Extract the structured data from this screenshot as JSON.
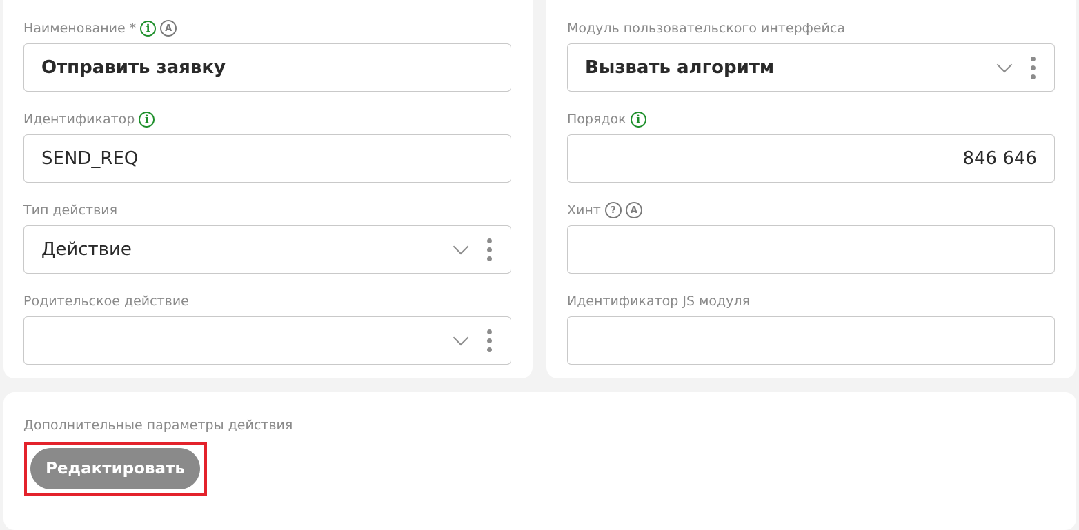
{
  "left_column": {
    "name": {
      "label": "Наименование",
      "required_mark": "*",
      "value": "Отправить заявку",
      "info_icon": "info-icon",
      "auto_icon": "A"
    },
    "identifier": {
      "label": "Идентификатор",
      "value": "SEND_REQ",
      "info_icon": "info-icon"
    },
    "action_type": {
      "label": "Тип действия",
      "value": "Действие"
    },
    "parent_action": {
      "label": "Родительское действие",
      "value": ""
    }
  },
  "right_column": {
    "ui_module": {
      "label": "Модуль пользовательского интерфейса",
      "value": "Вызвать алгоритм"
    },
    "order": {
      "label": "Порядок",
      "value": "846 646",
      "info_icon": "info-icon"
    },
    "hint": {
      "label": "Хинт",
      "value": "",
      "help_icon": "?",
      "auto_icon": "A"
    },
    "js_module_id": {
      "label": "Идентификатор JS модуля",
      "value": ""
    }
  },
  "extra_params": {
    "label": "Дополнительные параметры действия",
    "edit_button": "Редактировать"
  },
  "colors": {
    "info_icon": "#1e8f2b",
    "highlight_outline": "#e3222b",
    "button_bg": "#8a8a8a"
  }
}
